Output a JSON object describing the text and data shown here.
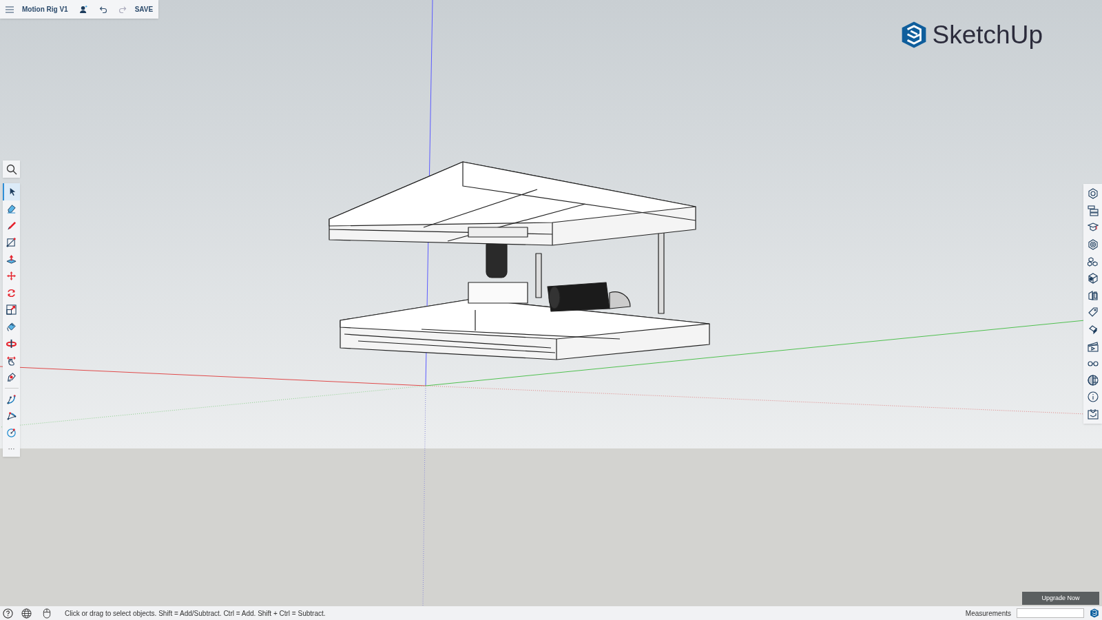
{
  "top_bar": {
    "title": "Motion Rig V1",
    "save": "SAVE"
  },
  "logo": {
    "text": "SketchUp"
  },
  "left_toolbar": {
    "tools": [
      {
        "selected": true
      },
      {
        "selected": false
      },
      {
        "selected": false
      },
      {
        "selected": false
      },
      {
        "selected": false
      },
      {
        "selected": false
      },
      {
        "selected": false
      },
      {
        "selected": false
      },
      {
        "selected": false
      },
      {
        "selected": false
      },
      {
        "selected": false
      },
      {
        "selected": false
      },
      {
        "selected": false
      },
      {
        "selected": false
      },
      {
        "selected": false
      }
    ],
    "more": "···"
  },
  "upgrade_button": "Upgrade Now",
  "status_bar": {
    "hint": "Click or drag to select objects. Shift = Add/Subtract. Ctrl = Add. Shift + Ctrl = Subtract.",
    "measurements_label": "Measurements"
  }
}
